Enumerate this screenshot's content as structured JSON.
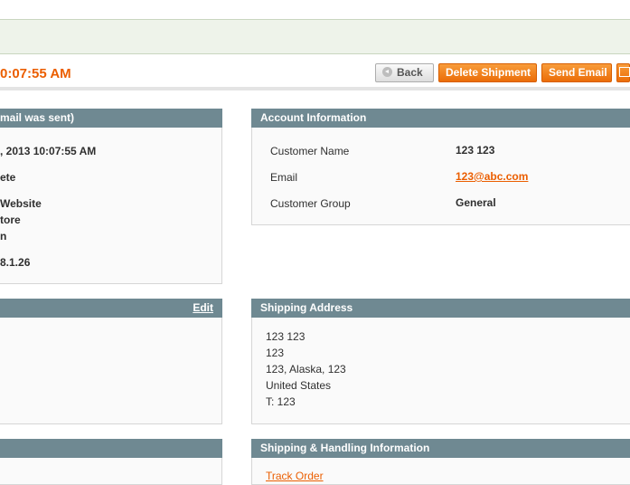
{
  "page": {
    "title": "0:07:55 AM"
  },
  "actions": {
    "back_label": "Back",
    "delete_label": "Delete Shipment",
    "send_email_label": "Send Email"
  },
  "order_panel": {
    "header": "mail was sent)",
    "lines": [
      ", 2013 10:07:55 AM",
      "ete",
      "Website",
      "tore",
      "n",
      "8.1.26"
    ]
  },
  "account_info": {
    "header": "Account Information",
    "rows": [
      {
        "label": "Customer Name",
        "value": "123 123"
      },
      {
        "label": "Email",
        "value": "123@abc.com"
      },
      {
        "label": "Customer Group",
        "value": "General"
      }
    ]
  },
  "billing_panel": {
    "edit_label": "Edit"
  },
  "shipping_address": {
    "header": "Shipping Address",
    "lines": [
      "123 123",
      "123",
      "123, Alaska, 123",
      "United States",
      "T: 123"
    ]
  },
  "shipping_handling": {
    "header": "Shipping & Handling Information",
    "track_label": "Track Order"
  },
  "colors": {
    "accent": "#eb5e00",
    "panel_header": "#6f8992",
    "button_orange": "#f08a24"
  }
}
